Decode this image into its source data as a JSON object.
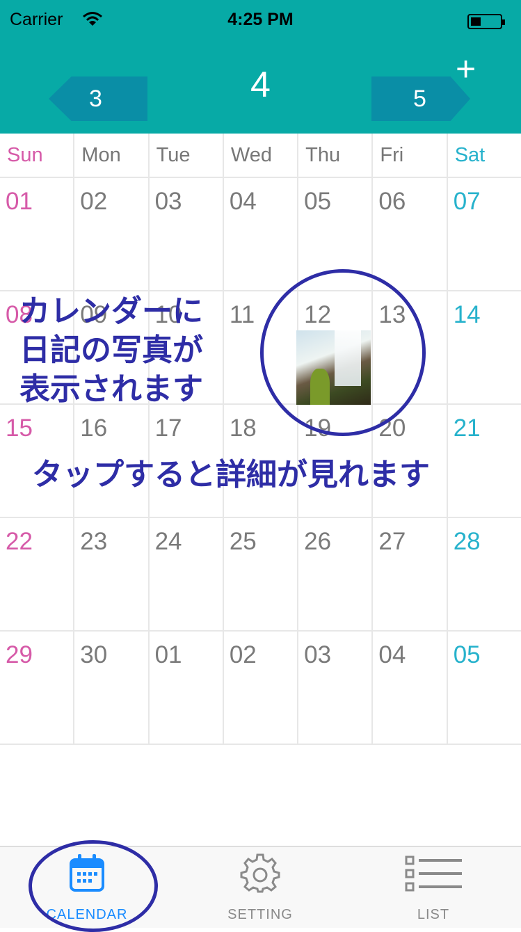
{
  "status_bar": {
    "carrier": "Carrier",
    "time": "4:25 PM"
  },
  "header": {
    "current_month": "4",
    "prev_month": "3",
    "next_month": "5",
    "add_label": "+"
  },
  "weekdays": [
    "Sun",
    "Mon",
    "Tue",
    "Wed",
    "Thu",
    "Fri",
    "Sat"
  ],
  "weeks": [
    [
      "01",
      "02",
      "03",
      "04",
      "05",
      "06",
      "07"
    ],
    [
      "08",
      "09",
      "10",
      "11",
      "12",
      "13",
      "14"
    ],
    [
      "15",
      "16",
      "17",
      "18",
      "19",
      "20",
      "21"
    ],
    [
      "22",
      "23",
      "24",
      "25",
      "26",
      "27",
      "28"
    ],
    [
      "29",
      "30",
      "01",
      "02",
      "03",
      "04",
      "05"
    ]
  ],
  "annotations": {
    "photo_note_line1": "カレンダーに",
    "photo_note_line2": "日記の写真が",
    "photo_note_line3": "表示されます",
    "tap_note": "タップすると詳細が見れます"
  },
  "tabs": [
    {
      "label": "CALENDAR",
      "icon": "calendar-icon"
    },
    {
      "label": "SETTING",
      "icon": "gear-icon"
    },
    {
      "label": "LIST",
      "icon": "list-icon"
    }
  ],
  "colors": {
    "header": "#07aaa6",
    "nav_arrow": "#0a8ea6",
    "sunday": "#d65aa8",
    "saturday": "#27b2cc",
    "annotation": "#2e2da6",
    "active_tab": "#1a8cff"
  }
}
